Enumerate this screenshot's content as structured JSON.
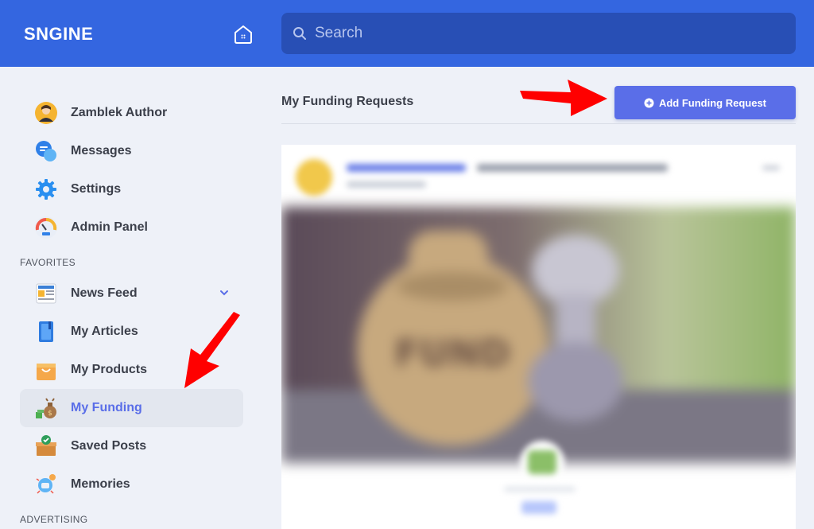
{
  "header": {
    "logo": "SNGINE",
    "search_placeholder": "Search"
  },
  "sidebar": {
    "user_items": [
      {
        "label": "Zamblek Author",
        "icon": "user-avatar-icon"
      },
      {
        "label": "Messages",
        "icon": "chat-bubbles-icon"
      },
      {
        "label": "Settings",
        "icon": "gear-icon"
      },
      {
        "label": "Admin Panel",
        "icon": "speedometer-icon"
      }
    ],
    "favorites_title": "FAVORITES",
    "favorites": [
      {
        "label": "News Feed",
        "icon": "newspaper-icon",
        "expandable": true
      },
      {
        "label": "My Articles",
        "icon": "notebook-icon"
      },
      {
        "label": "My Products",
        "icon": "shopping-bag-icon"
      },
      {
        "label": "My Funding",
        "icon": "money-bag-icon",
        "active": true
      },
      {
        "label": "Saved Posts",
        "icon": "saved-box-icon"
      },
      {
        "label": "Memories",
        "icon": "memories-icon"
      }
    ],
    "advertising_title": "ADVERTISING"
  },
  "main": {
    "title": "My Funding Requests",
    "add_button_label": "Add Funding Request"
  },
  "colors": {
    "header_bg": "#3466e0",
    "search_bg": "#284fb5",
    "accent": "#5a6ee8",
    "page_bg": "#eef1f8",
    "annotation_arrow": "#ff0000"
  }
}
